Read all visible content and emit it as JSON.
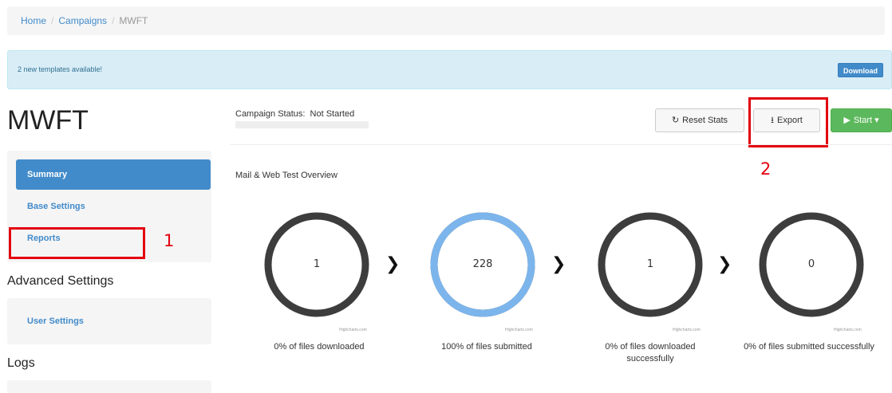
{
  "breadcrumb": {
    "home": "Home",
    "campaigns": "Campaigns",
    "current": "MWFT",
    "separator": "/"
  },
  "alert": {
    "message": "2 new templates available!",
    "button": "Download"
  },
  "page_title": "MWFT",
  "sidebar": {
    "items": [
      {
        "label": "Summary",
        "active": true
      },
      {
        "label": "Base Settings",
        "active": false
      },
      {
        "label": "Reports",
        "active": false
      }
    ],
    "advanced_heading": "Advanced Settings",
    "advanced_items": [
      {
        "label": "User Settings"
      }
    ],
    "logs_heading": "Logs"
  },
  "status": {
    "label": "Campaign Status:",
    "value": "Not Started",
    "text": "Campaign Status:  Not Started"
  },
  "toolbar": {
    "reset_label": "Reset Stats",
    "export_label": "Export",
    "start_label": "Start"
  },
  "overview_title": "Mail & Web Test Overview",
  "annotations": {
    "reports_number": "1",
    "export_number": "2",
    "color": "#e3000f"
  },
  "donuts": [
    {
      "value": "1",
      "caption": "0% of files downloaded",
      "fill_fraction": 0.0,
      "credit": "Highcharts.com"
    },
    {
      "value": "228",
      "caption": "100% of files submitted",
      "fill_fraction": 1.0,
      "credit": "Highcharts.com"
    },
    {
      "value": "1",
      "caption": "0% of files downloaded successfully",
      "fill_fraction": 0.0,
      "credit": "Highcharts.com"
    },
    {
      "value": "0",
      "caption": "0% of files submitted successfully",
      "fill_fraction": 0.0,
      "credit": "Highcharts.com"
    }
  ],
  "colors": {
    "primary": "#428bca",
    "success": "#5cb85c",
    "donut_empty": "#3d3d3d",
    "donut_full": "#7cb5ec",
    "alert_bg": "#d9edf7"
  },
  "icons": {
    "reset": "refresh-icon",
    "export": "export-icon",
    "start": "play-icon",
    "arrow": "chevron-right-icon"
  }
}
